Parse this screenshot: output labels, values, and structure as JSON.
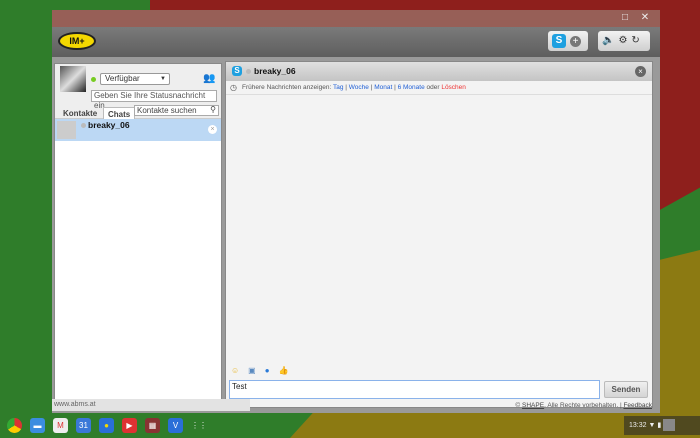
{
  "window": {
    "logo": "IM+"
  },
  "header": {
    "icons": [
      "skype-icon",
      "add-account-icon",
      "volume-icon",
      "settings-icon",
      "logout-icon"
    ]
  },
  "profile": {
    "status": "Verfügbar",
    "status_placeholder": "Geben Sie Ihre Statusnachricht ein"
  },
  "tabs": [
    {
      "label": "Kontakte"
    },
    {
      "label": "Chats",
      "active": true
    }
  ],
  "search": {
    "placeholder": "Kontakte suchen"
  },
  "contacts": [
    {
      "name": "breaky_06",
      "status_color": "#bbbbbb"
    }
  ],
  "chat": {
    "name": "breaky_06",
    "history_label": "Frühere Nachrichten anzeigen:",
    "history_links": [
      "Tag",
      "Woche",
      "Monat",
      "6 Monate"
    ],
    "or": "oder",
    "delete": "Löschen",
    "input_value": "Test",
    "send_label": "Senden"
  },
  "footer": {
    "url": "www.abms.at",
    "copyright": "© ",
    "shape": "SHAPE",
    "rights": ". Alle Rechte vorbehalten. | ",
    "feedback": "Feedback"
  },
  "taskbar": {
    "time": "13:32",
    "apps": [
      "chrome",
      "files",
      "gmail",
      "calendar",
      "im-plus",
      "youtube",
      "photo-booth",
      "app-v",
      "app-launcher"
    ]
  },
  "colors": {
    "accent": "#1ea0e0",
    "link": "#2261d6",
    "delete": "#ee3333",
    "selected_row": "#bcd8f4",
    "logo": "#f4d800"
  }
}
